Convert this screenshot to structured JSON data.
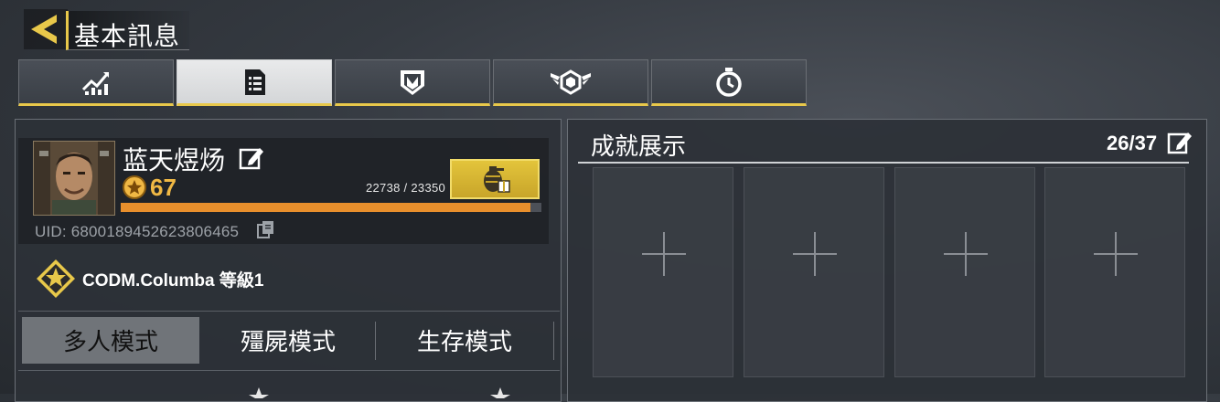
{
  "header": {
    "title": "基本訊息",
    "back_icon": "back-arrow-icon"
  },
  "tabs": [
    {
      "icon": "stats-chart-icon",
      "active": false
    },
    {
      "icon": "document-list-icon",
      "active": true
    },
    {
      "icon": "shield-emblem-icon",
      "active": false
    },
    {
      "icon": "winged-badge-icon",
      "active": false
    },
    {
      "icon": "stopwatch-icon",
      "active": false
    }
  ],
  "profile": {
    "name": "蓝天煜炀",
    "level": "67",
    "xp_text": "22738 / 23350",
    "xp_fraction": 0.974,
    "uid": "UID: 6800189452623806465",
    "rank_text": "CODM.Columba 等級1"
  },
  "modes": [
    "多人模式",
    "殭屍模式",
    "生存模式"
  ],
  "achievements": {
    "title": "成就展示",
    "count": "26/37",
    "slots": 4
  },
  "colors": {
    "accent": "#e8c84a",
    "xp": "#e88f2c",
    "level": "#f0b844"
  }
}
